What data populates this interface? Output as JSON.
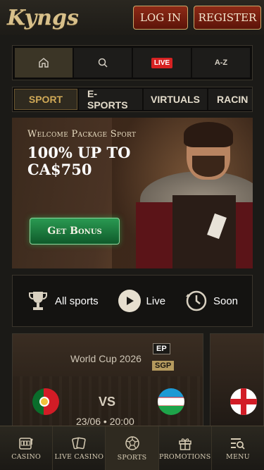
{
  "header": {
    "logo": "Kyngs",
    "login_label": "LOG IN",
    "register_label": "REGISTER"
  },
  "quick_nav": {
    "items": [
      {
        "name": "home",
        "icon": "home-icon"
      },
      {
        "name": "search",
        "icon": "search-icon"
      },
      {
        "name": "live",
        "label": "LIVE"
      },
      {
        "name": "a-z",
        "label": "A-Z"
      }
    ]
  },
  "category_tabs": [
    "SPORT",
    "E-SPORTS",
    "VIRTUALS",
    "RACIN"
  ],
  "banner": {
    "subtitle": "Welcome Package Sport",
    "title": "100% UP TO CA$750",
    "cta": "Get Bonus"
  },
  "sport_filters": [
    {
      "label": "All sports",
      "icon": "trophy-icon"
    },
    {
      "label": "Live",
      "icon": "play-icon"
    },
    {
      "label": "Soon",
      "icon": "clock-history-icon"
    }
  ],
  "match": {
    "league": "World Cup 2026",
    "badges": [
      "EP",
      "SGP"
    ],
    "home_flag": "portugal-flag",
    "away_flag": "uzbekistan-flag",
    "vs": "VS",
    "time": "23/06 • 20:00"
  },
  "match2": {
    "home_flag": "england-flag"
  },
  "bottom_nav": [
    {
      "label": "CASINO",
      "icon": "slot-machine-icon"
    },
    {
      "label": "LIVE CASINO",
      "icon": "cards-icon"
    },
    {
      "label": "SPORTS",
      "icon": "football-icon"
    },
    {
      "label": "PROMOTIONS",
      "icon": "gift-icon"
    },
    {
      "label": "MENU",
      "icon": "menu-search-icon"
    }
  ],
  "colors": {
    "accent_gold": "#d0a957",
    "header_button_red": "#8e2a16",
    "cta_green": "#1e8a45",
    "live_red": "#d62222"
  }
}
